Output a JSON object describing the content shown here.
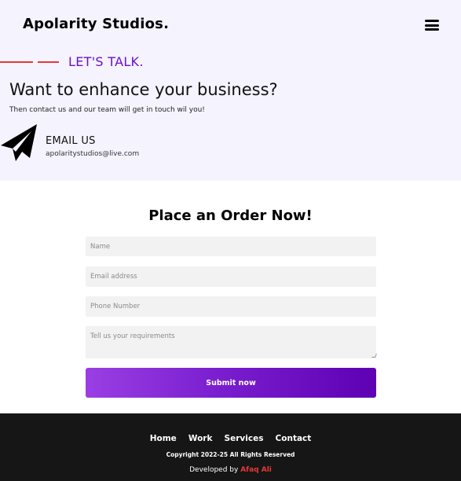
{
  "header": {
    "brand": "Apolarity Studios.",
    "menu_icon": "hamburger-menu-icon"
  },
  "hero": {
    "kicker": "LET'S TALK.",
    "headline": "Want to enhance your business?",
    "subline": "Then contact us and our team will get in touch wil you!",
    "email_icon": "paper-plane-icon",
    "email_title": "EMAIL US",
    "email_address": "apolaritystudios@live.com"
  },
  "order_form": {
    "title": "Place an Order Now!",
    "name_placeholder": "Name",
    "email_placeholder": "Email address",
    "phone_placeholder": "Phone Number",
    "requirements_placeholder": "Tell us your requirements",
    "submit_label": "Submit now"
  },
  "footer": {
    "nav": [
      "Home",
      "Work",
      "Services",
      "Contact"
    ],
    "copyright": "Copyright 2022-25 All Rights Reserved",
    "developed_prefix": "Developed by",
    "developer_name": "Afaq Ali"
  },
  "colors": {
    "accent_purple": "#6a11cb",
    "accent_red": "#e53935",
    "hero_bg": "#f5f3fe",
    "footer_bg": "#161616"
  }
}
